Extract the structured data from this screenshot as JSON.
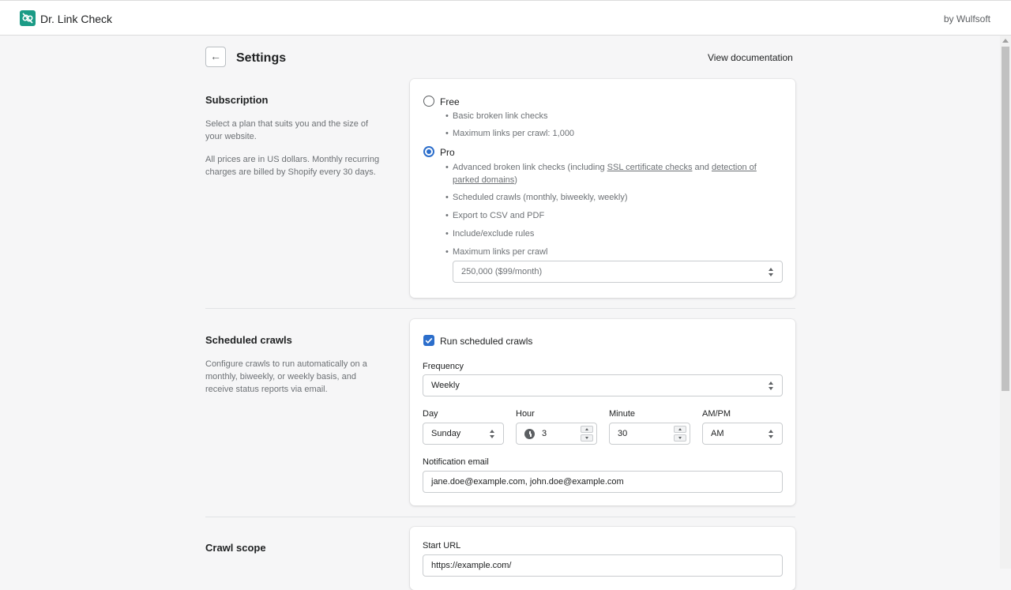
{
  "app": {
    "title": "Dr. Link Check",
    "byline": "by Wulfsoft"
  },
  "page": {
    "title": "Settings",
    "back_glyph": "←",
    "doc_link": "View documentation"
  },
  "subscription": {
    "title": "Subscription",
    "desc1": "Select a plan that suits you and the size of your website.",
    "desc2": "All prices are in US dollars. Monthly recurring charges are billed by Shopify every 30 days.",
    "selected_plan": "Pro",
    "free": {
      "label": "Free",
      "features": [
        "Basic broken link checks",
        "Maximum links per crawl: 1,000"
      ]
    },
    "pro": {
      "label": "Pro",
      "feature1_pre": "Advanced broken link checks (including ",
      "feature1_link1": "SSL certificate checks",
      "feature1_mid": " and ",
      "feature1_link2": "detection of parked domains",
      "feature1_post": ")",
      "features": [
        "Scheduled crawls (monthly, biweekly, weekly)",
        "Export to CSV and PDF",
        "Include/exclude rules",
        "Maximum links per crawl"
      ],
      "max_links_value": "250,000 ($99/month)"
    }
  },
  "scheduled": {
    "title": "Scheduled crawls",
    "desc": "Configure crawls to run automatically on a monthly, biweekly, or weekly basis, and receive status reports via email.",
    "run_label": "Run scheduled crawls",
    "run_checked": true,
    "frequency_label": "Frequency",
    "frequency_value": "Weekly",
    "day_label": "Day",
    "day_value": "Sunday",
    "hour_label": "Hour",
    "hour_value": "3",
    "minute_label": "Minute",
    "minute_value": "30",
    "ampm_label": "AM/PM",
    "ampm_value": "AM",
    "email_label": "Notification email",
    "email_value": "jane.doe@example.com, john.doe@example.com"
  },
  "scope": {
    "title": "Crawl scope",
    "start_url_label": "Start URL",
    "start_url_value": "https://example.com/"
  },
  "colors": {
    "accent": "#2c6ecb",
    "brand": "#1b9b86"
  }
}
